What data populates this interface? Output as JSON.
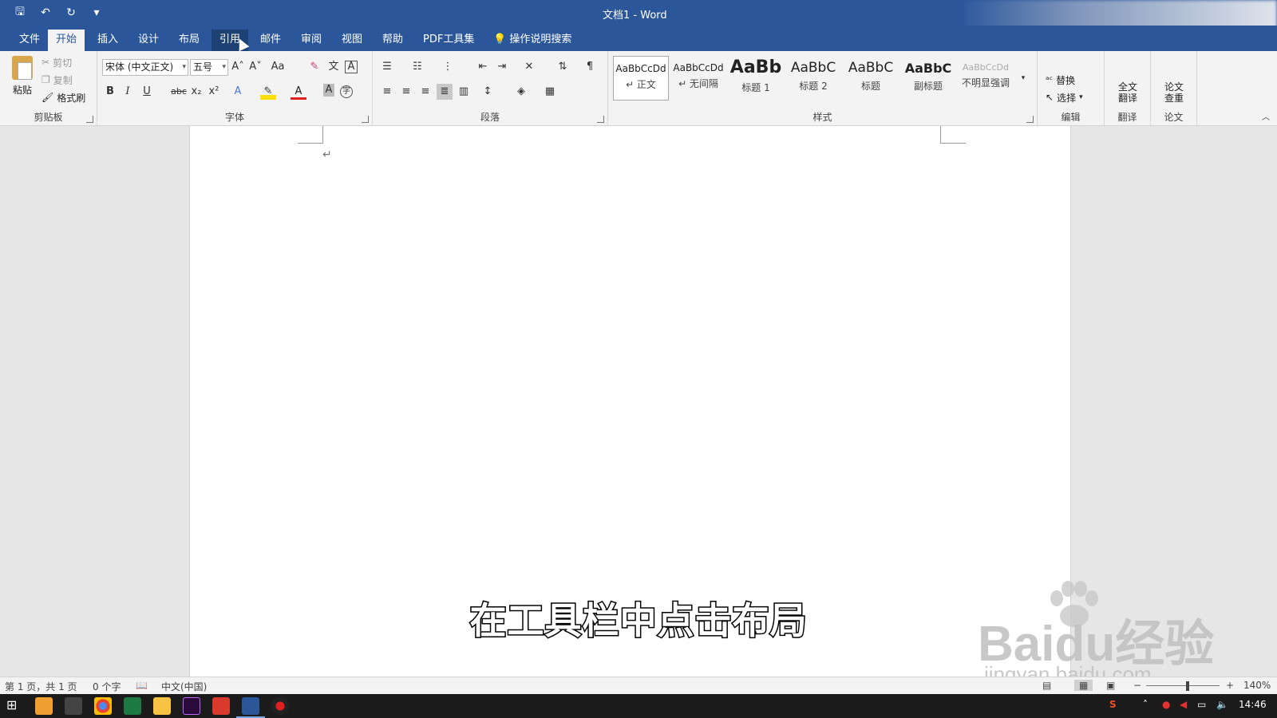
{
  "window": {
    "title": "文档1  -  Word"
  },
  "qat": {
    "save": "🖫",
    "undo": "↶",
    "redo": "↻",
    "customize": "▾"
  },
  "tabs": [
    "文件",
    "开始",
    "插入",
    "设计",
    "布局",
    "引用",
    "邮件",
    "审阅",
    "视图",
    "帮助",
    "PDF工具集"
  ],
  "tell_me": "操作说明搜索",
  "clipboard": {
    "paste": "粘贴",
    "cut": "剪切",
    "copy": "复制",
    "format_painter": "格式刷",
    "label": "剪贴板"
  },
  "font": {
    "name": "宋体 (中文正文)",
    "size": "五号",
    "label": "字体",
    "bold": "B",
    "italic": "I",
    "underline": "U",
    "strike": "abc",
    "sub": "x₂",
    "sup": "x²"
  },
  "paragraph": {
    "label": "段落"
  },
  "styles": {
    "label": "样式",
    "items": [
      {
        "sample": "AaBbCcDd",
        "name": "↵ 正文"
      },
      {
        "sample": "AaBbCcDd",
        "name": "↵ 无间隔"
      },
      {
        "sample": "AaBb",
        "name": "标题 1"
      },
      {
        "sample": "AaBbC",
        "name": "标题 2"
      },
      {
        "sample": "AaBbC",
        "name": "标题"
      },
      {
        "sample": "AaBbC",
        "name": "副标题"
      },
      {
        "sample": "AaBbCcDd",
        "name": "不明显强调"
      }
    ]
  },
  "editing": {
    "replace": "替换",
    "select": "选择",
    "label": "编辑"
  },
  "translate": {
    "button": "全文\n翻译",
    "label": "翻译"
  },
  "paper": {
    "button": "论文\n查重",
    "label": "论文"
  },
  "document": {
    "paragraph_mark": "↵"
  },
  "subtitle": "在工具栏中点击布局",
  "watermark": {
    "main": "Baidu经验",
    "sub": "jingyan.baidu.com"
  },
  "status": {
    "page": "第 1 页，共 1 页",
    "words": "0 个字",
    "language": "中文(中国)",
    "zoom": "140%"
  },
  "taskbar": {
    "time": "14:46"
  }
}
